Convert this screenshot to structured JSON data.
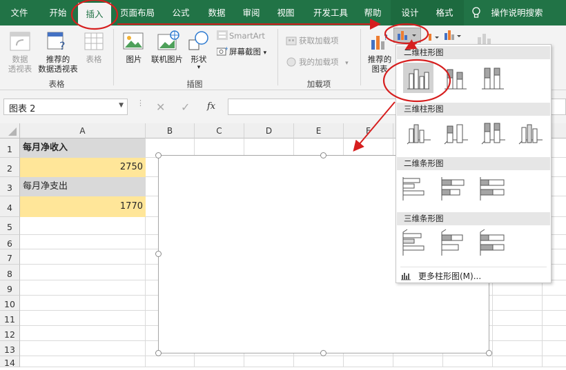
{
  "tabs": {
    "file": "文件",
    "home": "开始",
    "insert": "插入",
    "page_layout": "页面布局",
    "formulas": "公式",
    "data": "数据",
    "review": "审阅",
    "view": "视图",
    "developer": "开发工具",
    "help": "帮助",
    "design": "设计",
    "format": "格式",
    "tell_me": "操作说明搜索"
  },
  "ribbon": {
    "pivot_table": [
      "数据",
      "透视表"
    ],
    "recommended_pivot": [
      "推荐的",
      "数据透视表"
    ],
    "table": "表格",
    "group_tables": "表格",
    "pictures": "图片",
    "online_pictures": "联机图片",
    "shapes": "形状",
    "smartart": "SmartArt",
    "screenshot": "屏幕截图",
    "group_illustrations": "插图",
    "get_addins": "获取加载项",
    "my_addins": "我的加载项",
    "group_addins": "加载项",
    "recommended_charts": [
      "推荐的",
      "图表"
    ]
  },
  "formula_bar": {
    "name_box": "图表 2",
    "fx": "fx",
    "value": ""
  },
  "grid": {
    "columns": [
      "A",
      "B",
      "C",
      "D",
      "E",
      "F"
    ],
    "rows": [
      "1",
      "2",
      "3",
      "4",
      "5",
      "6",
      "7",
      "8",
      "9",
      "10",
      "11",
      "12",
      "13",
      "14"
    ],
    "cells": {
      "A1": "每月净收入",
      "A2": "2750",
      "A3": "每月净支出",
      "A4": "1770"
    }
  },
  "dropdown": {
    "sections": [
      "二维柱形图",
      "三维柱形图",
      "二维条形图",
      "三维条形图"
    ],
    "more": "更多柱形图(M)..."
  },
  "colors": {
    "ribbon_green": "#217346",
    "header_fill": "#d9d9d9",
    "value_fill": "#ffe699",
    "annotation_red": "#d61e1e"
  }
}
